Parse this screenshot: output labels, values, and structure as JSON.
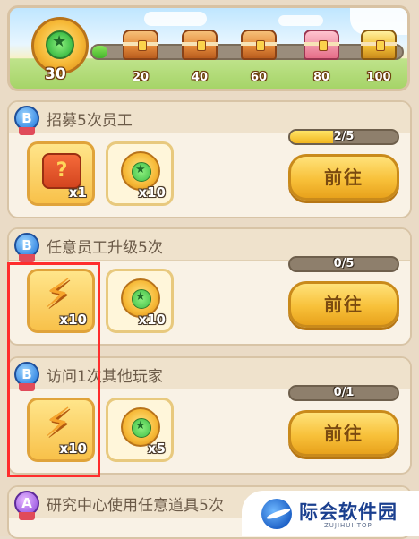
{
  "banner": {
    "current_points": "30",
    "progress_fraction": 0.05,
    "milestones": [
      {
        "label": "20",
        "chest": "orange-chest"
      },
      {
        "label": "40",
        "chest": "orange-chest"
      },
      {
        "label": "60",
        "chest": "orange-chest"
      },
      {
        "label": "80",
        "chest": "pink-chest"
      },
      {
        "label": "100",
        "chest": "gold-chest"
      }
    ]
  },
  "tasks": [
    {
      "grade": "B",
      "title": "招募5次员工",
      "rewards": [
        {
          "icon": "recruit-ticket-icon",
          "qty": "x1"
        },
        {
          "icon": "activity-coin-icon",
          "qty": "x10"
        }
      ],
      "progress_text": "2/5",
      "progress_fraction": 0.4,
      "button": "前往"
    },
    {
      "grade": "B",
      "title": "任意员工升级5次",
      "rewards": [
        {
          "icon": "lightning-energy-icon",
          "qty": "x10"
        },
        {
          "icon": "activity-coin-icon",
          "qty": "x10"
        }
      ],
      "progress_text": "0/5",
      "progress_fraction": 0,
      "button": "前往"
    },
    {
      "grade": "B",
      "title": "访问1次其他玩家",
      "rewards": [
        {
          "icon": "lightning-energy-icon",
          "qty": "x10"
        },
        {
          "icon": "activity-coin-icon",
          "qty": "x5"
        }
      ],
      "progress_text": "0/1",
      "progress_fraction": 0,
      "button": "前往"
    },
    {
      "grade": "A",
      "title": "研究中心使用任意道具5次"
    }
  ],
  "watermark": {
    "name": "际会软件园",
    "sub": "ZUJIHUI.TOP"
  }
}
